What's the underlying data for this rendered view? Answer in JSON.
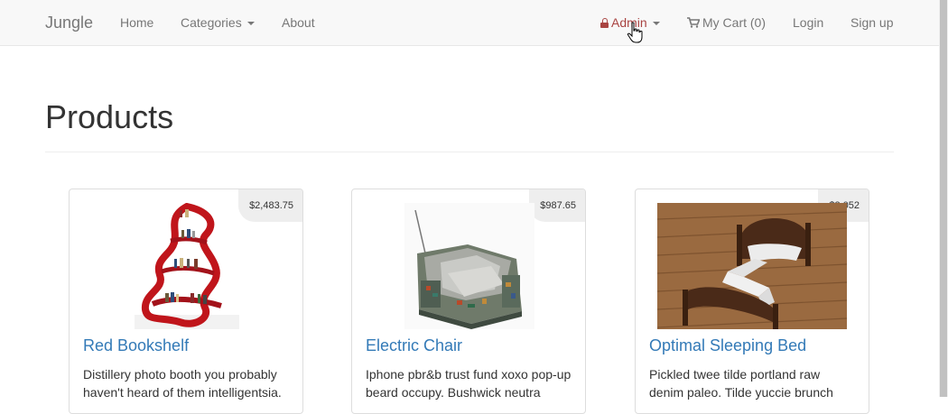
{
  "navbar": {
    "brand": "Jungle",
    "home": "Home",
    "categories": "Categories",
    "about": "About",
    "admin": "Admin",
    "cart": "My Cart (0)",
    "login": "Login",
    "signup": "Sign up"
  },
  "page": {
    "title": "Products"
  },
  "products": [
    {
      "name": "Red Bookshelf",
      "price": "$2,483.75",
      "description": "Distillery photo booth you probably haven't heard of them intelligentsia."
    },
    {
      "name": "Electric Chair",
      "price": "$987.65",
      "description": "Iphone pbr&b trust fund xoxo pop-up beard occupy. Bushwick neutra"
    },
    {
      "name": "Optimal Sleeping Bed",
      "price": "$3,052",
      "description": "Pickled twee tilde portland raw denim paleo. Tilde yuccie brunch"
    }
  ],
  "colors": {
    "link": "#337ab7",
    "admin": "#a94442",
    "navbar_bg": "#f8f8f8",
    "badge_bg": "#eeeeee"
  },
  "icons": [
    "lock-icon",
    "shopping-cart-icon",
    "caret-down-icon",
    "hand-pointer-cursor-icon"
  ]
}
